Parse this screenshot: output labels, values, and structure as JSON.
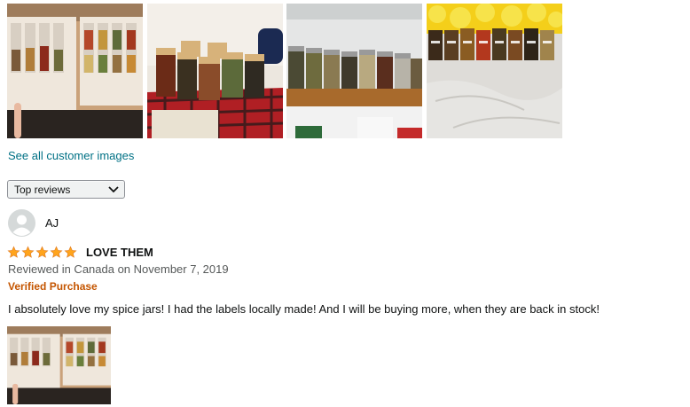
{
  "customer_images": {
    "thumbnails": [
      {
        "icon": "spice-rack-drawer-photo"
      },
      {
        "icon": "bamboo-lid-jars-photo"
      },
      {
        "icon": "shelf-jars-photo"
      },
      {
        "icon": "labeled-jars-photo"
      }
    ],
    "see_all_label": "See all customer images"
  },
  "sort": {
    "selected": "Top reviews",
    "icon": "chevron-down-icon"
  },
  "review": {
    "author": "AJ",
    "avatar_icon": "default-avatar-icon",
    "rating": 5,
    "rating_max": 5,
    "title": "LOVE THEM",
    "meta": "Reviewed in Canada on November 7, 2019",
    "verified": "Verified Purchase",
    "body": "I absolutely love my spice jars! I had the labels locally made! And I will be buying more, when they are back in stock!",
    "image_icon": "spice-rack-drawer-photo"
  },
  "colors": {
    "link": "#007185",
    "verified": "#c45500",
    "star": "#ffa41c",
    "meta": "#565959"
  }
}
